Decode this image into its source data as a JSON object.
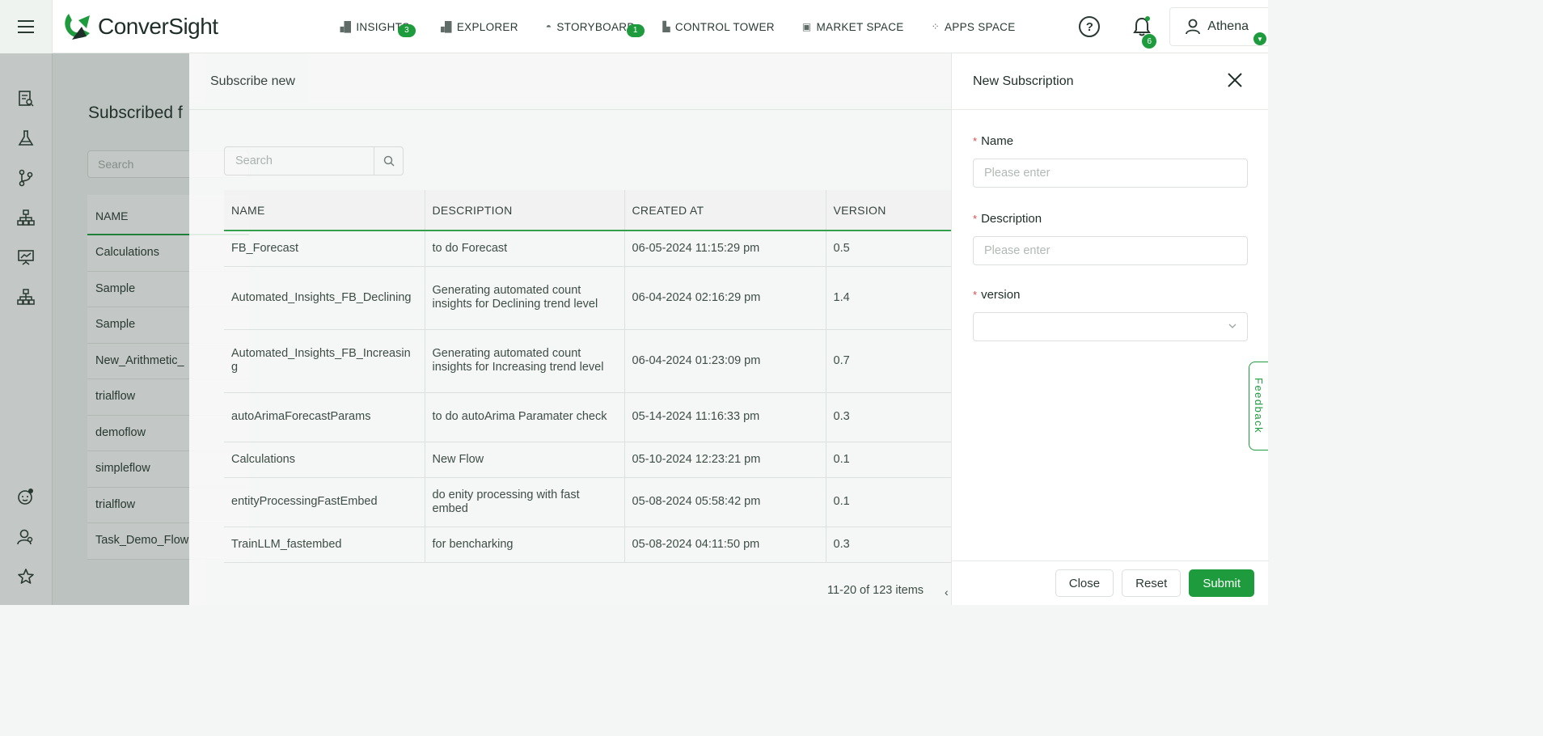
{
  "app": {
    "brand": "ConverSight",
    "colors": {
      "accent": "#1e9b3c",
      "text": "#2a3a33",
      "required": "#e04848"
    }
  },
  "nav": [
    {
      "label": "INSIGHTS",
      "icon": "bar-chart-icon",
      "badge": "3"
    },
    {
      "label": "EXPLORER",
      "icon": "bar-chart-icon",
      "badge": ""
    },
    {
      "label": "STORYBOARD",
      "icon": "storyboard-icon",
      "badge": "1"
    },
    {
      "label": "CONTROL TOWER",
      "icon": "factory-icon",
      "badge": ""
    },
    {
      "label": "MARKET SPACE",
      "icon": "store-icon",
      "badge": ""
    },
    {
      "label": "APPS SPACE",
      "icon": "apps-grid-icon",
      "badge": ""
    }
  ],
  "topright": {
    "notifications": "6",
    "user": "Athena"
  },
  "base": {
    "title": "Subscribed f",
    "search_placeholder": "Search",
    "column": "NAME",
    "rows": [
      "Calculations",
      "Sample",
      "Sample",
      "New_Arithmetic_",
      "trialflow",
      "demoflow",
      "simpleflow",
      "trialflow",
      "Task_Demo_Flow"
    ]
  },
  "subscribe": {
    "title": "Subscribe new",
    "search_placeholder": "Search",
    "columns": [
      "NAME",
      "DESCRIPTION",
      "CREATED AT",
      "VERSION"
    ],
    "rows": [
      [
        "FB_Forecast",
        "to do Forecast",
        "06-05-2024 11:15:29 pm",
        "0.5"
      ],
      [
        "Automated_Insights_FB_Declining",
        "Generating automated count insights for Declining trend level",
        "06-04-2024 02:16:29 pm",
        "1.4"
      ],
      [
        "Automated_Insights_FB_Increasing",
        "Generating automated count insights for Increasing trend level",
        "06-04-2024 01:23:09 pm",
        "0.7"
      ],
      [
        "autoArimaForecastParams",
        "to do autoArima Paramater check",
        "05-14-2024 11:16:33 pm",
        "0.3"
      ],
      [
        "Calculations",
        "New Flow",
        "05-10-2024 12:23:21 pm",
        "0.1"
      ],
      [
        "entityProcessingFastEmbed",
        "do enity processing with fast embed",
        "05-08-2024 05:58:42 pm",
        "0.1"
      ],
      [
        "TrainLLM_fastembed",
        "for bencharking",
        "05-08-2024 04:11:50 pm",
        "0.3"
      ]
    ],
    "pagination": "11-20 of 123 items"
  },
  "new_subscription": {
    "title": "New Subscription",
    "fields": [
      {
        "label": "Name",
        "placeholder": "Please enter"
      },
      {
        "label": "Description",
        "placeholder": "Please enter"
      },
      {
        "label": "version",
        "placeholder": ""
      }
    ],
    "buttons": {
      "close": "Close",
      "reset": "Reset",
      "submit": "Submit"
    }
  },
  "feedback": "Feedback"
}
